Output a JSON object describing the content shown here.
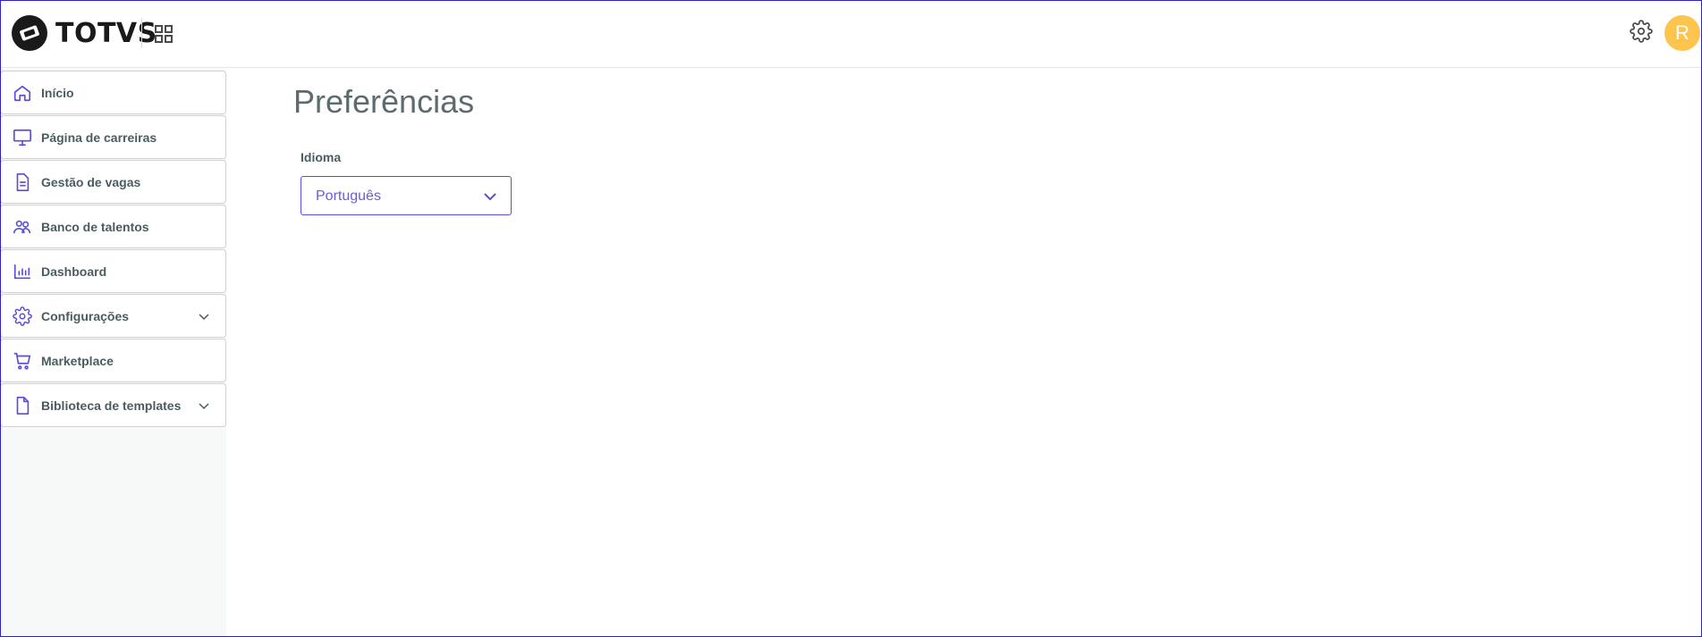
{
  "header": {
    "logo_text": "TOTVS",
    "avatar_initial": "R",
    "avatar_color": "#fdc44e"
  },
  "sidebar": {
    "items": [
      {
        "label": "Início",
        "icon": "home-icon",
        "expandable": false
      },
      {
        "label": "Página de carreiras",
        "icon": "monitor-icon",
        "expandable": false
      },
      {
        "label": "Gestão de vagas",
        "icon": "document-icon",
        "expandable": false
      },
      {
        "label": "Banco de talentos",
        "icon": "users-icon",
        "expandable": false
      },
      {
        "label": "Dashboard",
        "icon": "bar-chart-icon",
        "expandable": false
      },
      {
        "label": "Configurações",
        "icon": "gear-icon",
        "expandable": true
      },
      {
        "label": "Marketplace",
        "icon": "cart-icon",
        "expandable": false
      },
      {
        "label": "Biblioteca de templates",
        "icon": "file-icon",
        "expandable": true
      }
    ]
  },
  "main": {
    "title": "Preferências",
    "language_field": {
      "label": "Idioma",
      "value": "Português"
    }
  },
  "colors": {
    "accent": "#5b4ed1",
    "border_frame": "#2b1fd6",
    "icon_purple": "#5b4ed1"
  }
}
